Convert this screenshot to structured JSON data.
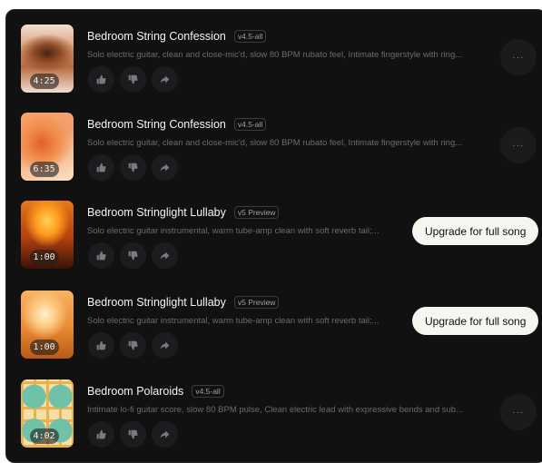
{
  "songs": [
    {
      "title": "Bedroom String Confession",
      "version": "v4.5-all",
      "description": "Solo electric guitar, clean and close-mic'd, slow 80 BPM rubato feel, Intimate fingerstyle with ring...",
      "duration": "4:25",
      "upgrade_label": "",
      "more_label": "···",
      "thumb_gradient": "radial-gradient(ellipse 55% 28% at 50% 42%, #4a2412 0%, #8e4a26 45%, rgba(200,130,90,0) 100%), linear-gradient(180deg, #f3ddd0 0%, #d79a74 38%, #b86a40 62%, #f1ddd2 100%)"
    },
    {
      "title": "Bedroom String Confession",
      "version": "v4.5-all",
      "description": "Solo electric guitar, clean and close-mic'd, slow 80 BPM rubato feel, Intimate fingerstyle with ring...",
      "duration": "6:35",
      "upgrade_label": "",
      "more_label": "···",
      "thumb_gradient": "radial-gradient(ellipse 70% 55% at 40% 45%, #e0612c 0%, #f08a48 40%, rgba(255,200,150,0) 80%), linear-gradient(160deg, #f6a36a 0%, #f2a06c 40%, #fbe2c9 100%)"
    },
    {
      "title": "Bedroom Stringlight Lullaby",
      "version": "v5 Preview",
      "description": "Solo electric guitar instrumental, warm tube-amp clean with soft reverb tail;...",
      "duration": "1:00",
      "upgrade_label": "Upgrade for full song",
      "more_label": "",
      "thumb_gradient": "radial-gradient(ellipse 50% 45% at 50% 30%, #ffd15a 0%, #ff9a1c 45%, rgba(150,40,0,0) 85%), linear-gradient(180deg, #e7761a 0%, #b04010 55%, #3a1206 100%)"
    },
    {
      "title": "Bedroom Stringlight Lullaby",
      "version": "v5 Preview",
      "description": "Solo electric guitar instrumental, warm tube-amp clean with soft reverb tail;...",
      "duration": "1:00",
      "upgrade_label": "Upgrade for full song",
      "more_label": "",
      "thumb_gradient": "radial-gradient(ellipse 55% 45% at 45% 35%, #fff0d0 0%, #ffcf8a 35%, rgba(240,130,40,0) 80%), linear-gradient(180deg, #f8b463 0%, #e98a33 55%, #b85a18 100%)"
    },
    {
      "title": "Bedroom Polaroids",
      "version": "v4.5-all",
      "description": "Intimate lo-fi guitar score, slow 80 BPM pulse, Clean electric lead with expressive bends and sub...",
      "duration": "4:02",
      "upgrade_label": "",
      "more_label": "···",
      "thumb_gradient": "radial-gradient(circle at 25% 25%, #6fc2a8 0 18%, transparent 19%), radial-gradient(circle at 75% 25%, #6fc2a8 0 18%, transparent 19%), radial-gradient(circle at 25% 75%, #6fc2a8 0 18%, transparent 19%), radial-gradient(circle at 75% 75%, #6fc2a8 0 18%, transparent 19%), repeating-linear-gradient(90deg, #e9b24d 0 3px, transparent 3px 14px), repeating-linear-gradient(0deg, #e9b24d 0 3px, #f3dfa7 3px 14px)"
    }
  ],
  "icons": {
    "like": "thumbs-up-icon",
    "dislike": "thumbs-down-icon",
    "share": "share-arrow-icon",
    "more": "more-horizontal-icon"
  }
}
